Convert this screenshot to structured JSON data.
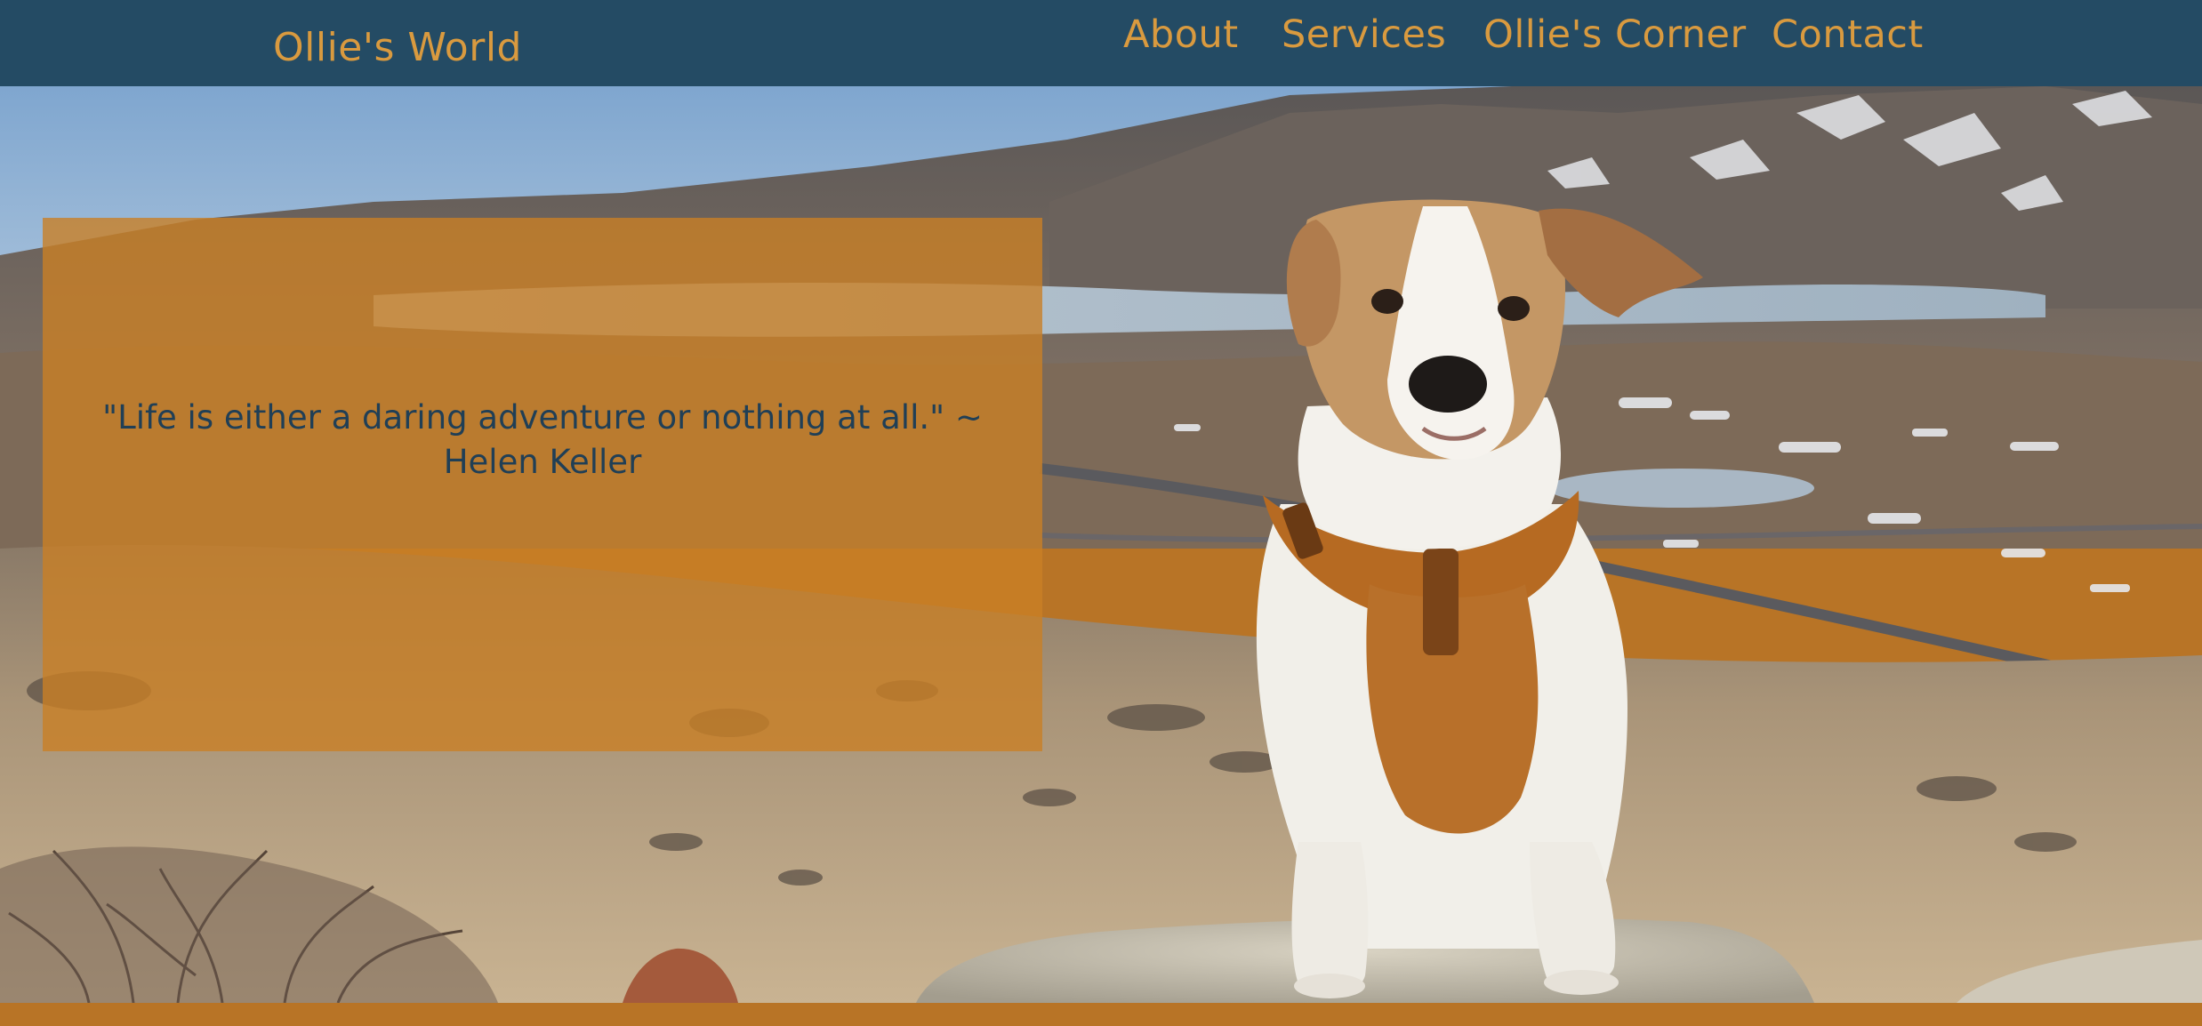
{
  "site": {
    "brand": "Ollie's World"
  },
  "nav": {
    "items": [
      {
        "label": "About"
      },
      {
        "label": "Services"
      },
      {
        "label": "Ollie's Corner"
      },
      {
        "label": "Contact"
      }
    ]
  },
  "hero": {
    "image_alt": "photo-dog-in-harness-sitting-on-rock-mountain-landscape",
    "quote": "\"Life is either a daring adventure or nothing at all.\" ~ Helen Keller"
  },
  "colors": {
    "nav_bg": "#244b64",
    "brand_text": "#d99a3f",
    "accent_orange": "#c98026",
    "quote_text": "#203f56",
    "footer_bg": "#b87426"
  }
}
